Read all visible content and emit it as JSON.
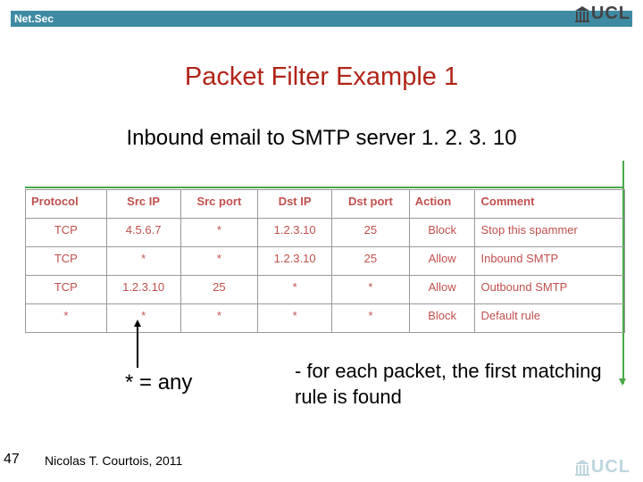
{
  "header": {
    "label": "Net.Sec",
    "logo_text": "UCL"
  },
  "title": "Packet Filter Example 1",
  "subtitle": "Inbound email to SMTP server 1. 2. 3. 10",
  "table": {
    "headers": [
      "Protocol",
      "Src IP",
      "Src port",
      "Dst IP",
      "Dst port",
      "Action",
      "Comment"
    ],
    "rows": [
      [
        "TCP",
        "4.5.6.7",
        "*",
        "1.2.3.10",
        "25",
        "Block",
        "Stop this spammer"
      ],
      [
        "TCP",
        "*",
        "*",
        "1.2.3.10",
        "25",
        "Allow",
        "Inbound SMTP"
      ],
      [
        "TCP",
        "1.2.3.10",
        "25",
        "*",
        "*",
        "Allow",
        "Outbound SMTP"
      ],
      [
        "*",
        "*",
        "*",
        "*",
        "*",
        "Block",
        "Default rule"
      ]
    ]
  },
  "legend": "* = any",
  "explain_prefix": "- for each packet, the ",
  "explain_em": "first matching rule",
  "explain_suffix": " is found",
  "slide_number": "47",
  "author": "Nicolas T. Courtois, 2011"
}
